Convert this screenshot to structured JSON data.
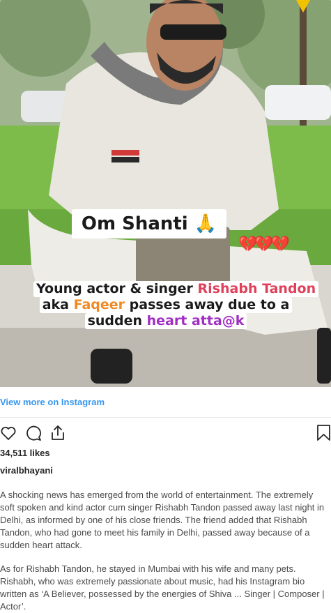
{
  "post": {
    "overlay_title": "Om Shanti 🙏",
    "hearts": "💔💔💔",
    "headline": {
      "line1_prefix": "Young actor & singer ",
      "line1_highlight": "Rishabh Tandon",
      "line2_prefix": "aka ",
      "line2_highlight": "Faqeer",
      "line2_suffix": " passes away due to a",
      "line3_prefix": "sudden ",
      "line3_highlight": "heart atta",
      "line3_suffix": "k"
    },
    "view_more": "View more on Instagram",
    "likes": "34,511 likes",
    "username": "viralbhayani",
    "paragraphs": [
      "A shocking news has emerged from the world of entertainment. The extremely soft spoken and kind actor cum singer Rishabh Tandon passed away last night in Delhi, as informed by one of his close friends. The friend added that Rishabh Tandon, who had gone to meet his family in Delhi, passed away because of a sudden heart attack.",
      "As for Rishabh Tandon, he stayed in Mumbai with his wife and many pets. Rishabh, who was extremely passionate about music, had his Instagram bio written as ‘A Believer, possessed by the energies of Shiva ... Singer | Composer | Actor’."
    ]
  },
  "icons": {
    "like": "heart-icon",
    "comment": "comment-icon",
    "share": "share-icon",
    "save": "bookmark-icon"
  },
  "colors": {
    "link": "#3897f0",
    "highlight_pink": "#e0405a",
    "highlight_orange": "#f08a24",
    "highlight_purple": "#a02ec2"
  }
}
